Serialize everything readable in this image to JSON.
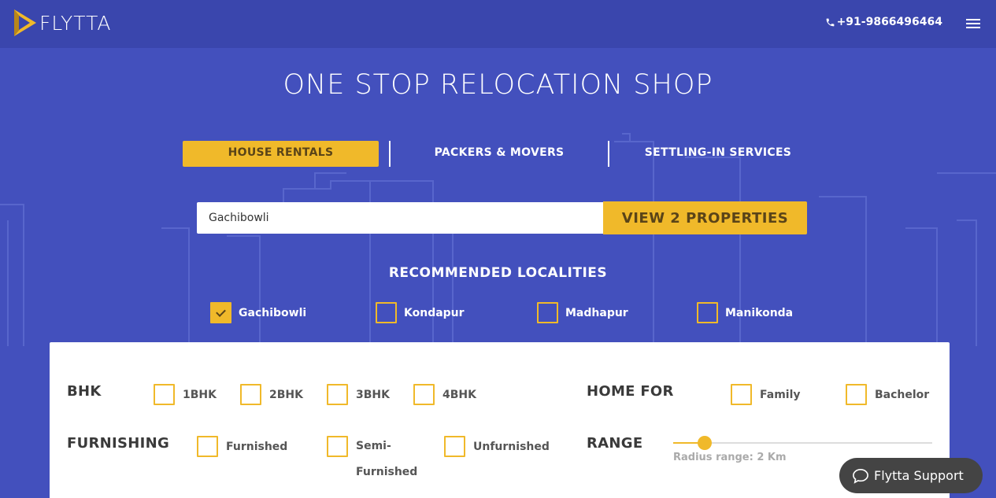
{
  "header": {
    "brand": "FLYTTA",
    "phone": "+91-9866496464",
    "menu_icon": "hamburger-icon"
  },
  "hero": {
    "title": "ONE STOP RELOCATION SHOP"
  },
  "tabs": [
    {
      "label": "HOUSE RENTALS",
      "active": true
    },
    {
      "label": "PACKERS & MOVERS",
      "active": false
    },
    {
      "label": "SETTLING-IN SERVICES",
      "active": false
    }
  ],
  "search": {
    "value": "Gachibowli",
    "button_label": "VIEW 2 PROPERTIES"
  },
  "recommended": {
    "title": "RECOMMENDED LOCALITIES",
    "items": [
      {
        "label": "Gachibowli",
        "checked": true
      },
      {
        "label": "Kondapur",
        "checked": false
      },
      {
        "label": "Madhapur",
        "checked": false
      },
      {
        "label": "Manikonda",
        "checked": false
      }
    ]
  },
  "filters": {
    "bhk": {
      "title": "BHK",
      "options": [
        "1BHK",
        "2BHK",
        "3BHK",
        "4BHK"
      ]
    },
    "home_for": {
      "title": "HOME FOR",
      "options": [
        "Family",
        "Bachelor"
      ]
    },
    "furnishing": {
      "title": "FURNISHING",
      "options": [
        "Furnished",
        "Semi-\nFurnished",
        "Unfurnished"
      ],
      "semi_line1": "Semi-",
      "semi_line2": "Furnished"
    },
    "range": {
      "title": "RANGE",
      "radius_text": "Radius range: 2 Km"
    }
  },
  "support": {
    "label": "Flytta Support"
  },
  "colors": {
    "background": "#4350bd",
    "header": "#3a46ad",
    "accent": "#f0b92a",
    "accent_text": "#5a4418"
  }
}
